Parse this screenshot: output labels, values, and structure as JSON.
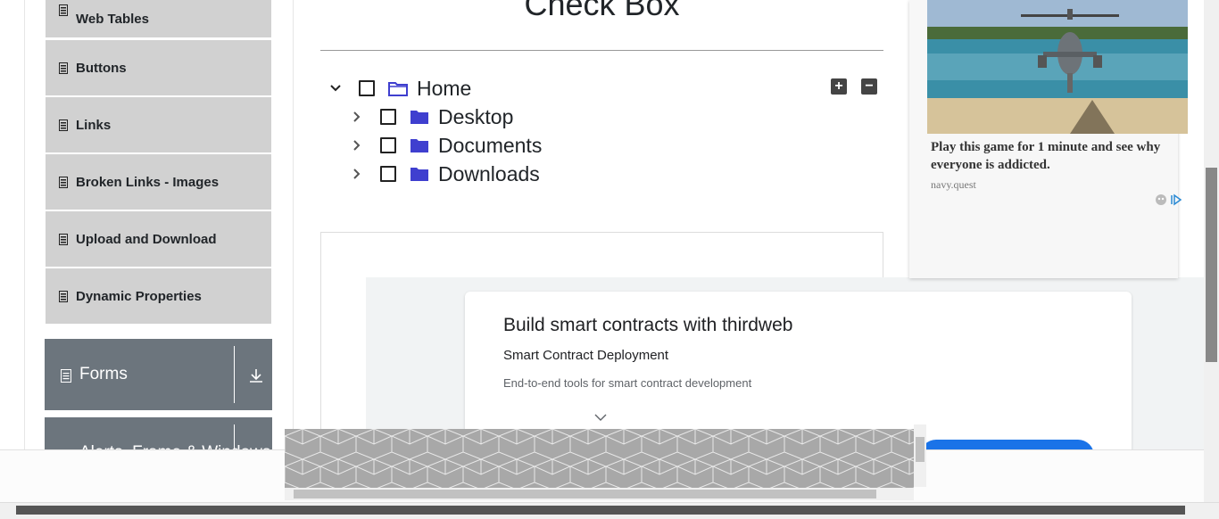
{
  "sidebar": {
    "items": [
      {
        "label": "Web Tables"
      },
      {
        "label": "Buttons"
      },
      {
        "label": "Links"
      },
      {
        "label": "Broken Links - Images"
      },
      {
        "label": "Upload and Download"
      },
      {
        "label": "Dynamic Properties"
      }
    ],
    "groups": [
      {
        "label": "Forms"
      },
      {
        "label": "Alerts, Frame & Windows"
      }
    ]
  },
  "main": {
    "title": "Check Box",
    "tree": {
      "root": "Home",
      "children": [
        "Desktop",
        "Documents",
        "Downloads"
      ]
    },
    "expand_all_label": "+",
    "collapse_all_label": "−"
  },
  "right_ad": {
    "headline": "Play this game for 1 minute and see why everyone is addicted.",
    "domain": "navy.quest"
  },
  "bottom_ad": {
    "headline": "Build smart contracts with thirdweb",
    "subheadline": "Smart Contract Deployment",
    "description": "End-to-end tools for smart contract development"
  },
  "colors": {
    "sidebar_item_bg": "#d1d1d1",
    "group_header_bg": "#6c757d",
    "folder_blue": "#3f3fcf",
    "cta_blue": "#1a73e8"
  }
}
